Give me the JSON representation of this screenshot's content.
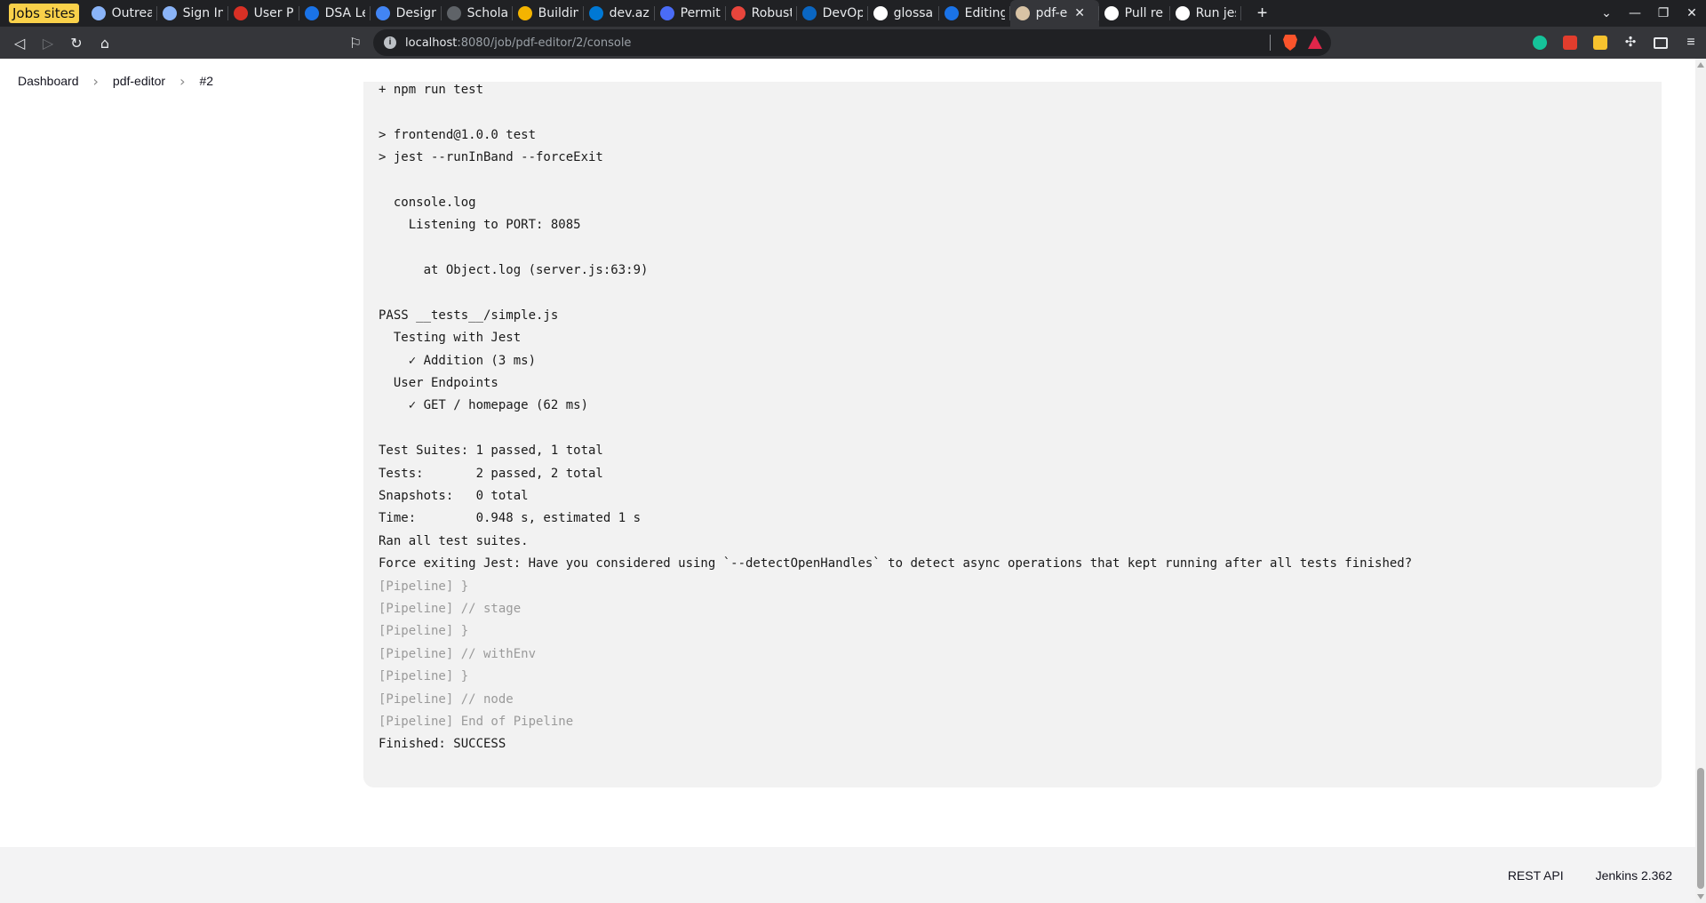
{
  "browser": {
    "tab_group_label": "Jobs sites",
    "tabs": [
      {
        "title": "Outreach",
        "color": "#8ab4f8",
        "glyph": "globe-icon"
      },
      {
        "title": "Sign In",
        "color": "#8ab4f8",
        "glyph": "globe-icon"
      },
      {
        "title": "User Pro",
        "color": "#d93025",
        "glyph": "user-icon"
      },
      {
        "title": "DSA Leet",
        "color": "#1a73e8",
        "glyph": "check-icon"
      },
      {
        "title": "Designin",
        "color": "#4285f4",
        "glyph": "design-icon"
      },
      {
        "title": "Scholars",
        "color": "#5f6368",
        "glyph": "scholar-icon"
      },
      {
        "title": "Building",
        "color": "#f4b400",
        "glyph": "box-icon"
      },
      {
        "title": "dev.azur",
        "color": "#0078d4",
        "glyph": "azure-icon"
      },
      {
        "title": "Permit.i",
        "color": "#4a6cf7",
        "glyph": "permit-icon"
      },
      {
        "title": "Robusta",
        "color": "#e8453c",
        "glyph": "robusta-icon"
      },
      {
        "title": "DevOps",
        "color": "#0a66c2",
        "glyph": "devops-icon"
      },
      {
        "title": "glossary",
        "color": "#ffffff",
        "glyph": "github-icon"
      },
      {
        "title": "Editing",
        "color": "#1a73e8",
        "glyph": "edit-icon"
      },
      {
        "title": "pdf-e",
        "color": "#d8c3a5",
        "glyph": "jenkins-icon",
        "active": true
      },
      {
        "title": "Pull re",
        "color": "#ffffff",
        "glyph": "github-icon"
      },
      {
        "title": "Run jest",
        "color": "#ffffff",
        "glyph": "github-icon"
      }
    ],
    "new_tab": "+",
    "url_host": "localhost",
    "url_rest": ":8080/job/pdf-editor/2/console"
  },
  "breadcrumb": {
    "items": [
      "Dashboard",
      "pdf-editor",
      "#2"
    ],
    "separator": "›"
  },
  "console": {
    "lines": [
      {
        "text": "+ npm run test",
        "dim": false
      },
      {
        "text": "",
        "dim": false
      },
      {
        "text": "> frontend@1.0.0 test",
        "dim": false
      },
      {
        "text": "> jest --runInBand --forceExit",
        "dim": false
      },
      {
        "text": "",
        "dim": false
      },
      {
        "text": "  console.log",
        "dim": false
      },
      {
        "text": "    Listening to PORT: 8085",
        "dim": false
      },
      {
        "text": "",
        "dim": false
      },
      {
        "text": "      at Object.log (server.js:63:9)",
        "dim": false
      },
      {
        "text": "",
        "dim": false
      },
      {
        "text": "PASS __tests__/simple.js",
        "dim": false
      },
      {
        "text": "  Testing with Jest",
        "dim": false
      },
      {
        "text": "    ✓ Addition (3 ms)",
        "dim": false
      },
      {
        "text": "  User Endpoints",
        "dim": false
      },
      {
        "text": "    ✓ GET / homepage (62 ms)",
        "dim": false
      },
      {
        "text": "",
        "dim": false
      },
      {
        "text": "Test Suites: 1 passed, 1 total",
        "dim": false
      },
      {
        "text": "Tests:       2 passed, 2 total",
        "dim": false
      },
      {
        "text": "Snapshots:   0 total",
        "dim": false
      },
      {
        "text": "Time:        0.948 s, estimated 1 s",
        "dim": false
      },
      {
        "text": "Ran all test suites.",
        "dim": false
      },
      {
        "text": "Force exiting Jest: Have you considered using `--detectOpenHandles` to detect async operations that kept running after all tests finished?",
        "dim": false
      },
      {
        "text": "[Pipeline] }",
        "dim": true
      },
      {
        "text": "[Pipeline] // stage",
        "dim": true
      },
      {
        "text": "[Pipeline] }",
        "dim": true
      },
      {
        "text": "[Pipeline] // withEnv",
        "dim": true
      },
      {
        "text": "[Pipeline] }",
        "dim": true
      },
      {
        "text": "[Pipeline] // node",
        "dim": true
      },
      {
        "text": "[Pipeline] End of Pipeline",
        "dim": true
      },
      {
        "text": "Finished: SUCCESS",
        "dim": false
      }
    ]
  },
  "footer": {
    "rest_api": "REST API",
    "version": "Jenkins 2.362"
  }
}
